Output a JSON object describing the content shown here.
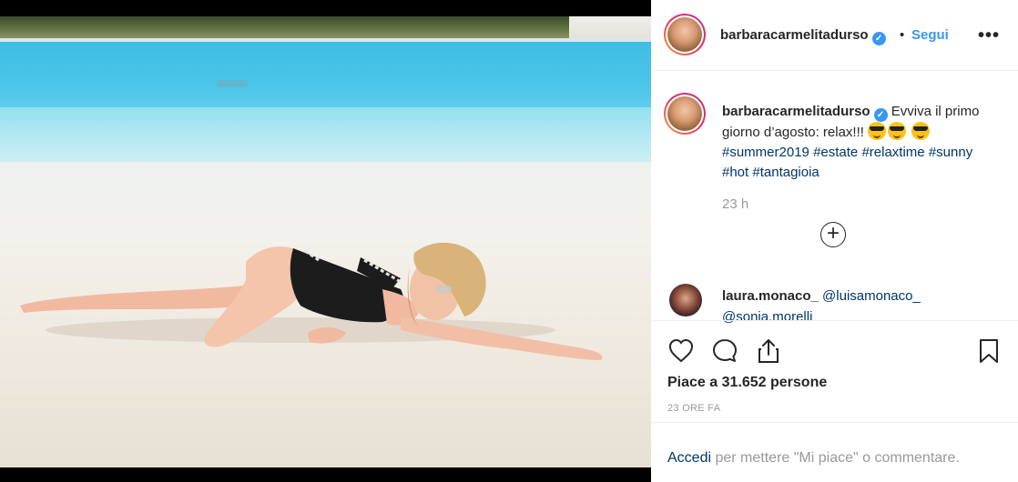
{
  "post": {
    "author": "barbaracarmelitadurso",
    "verified_mark": "✓",
    "dot": "•",
    "follow_label": "Segui",
    "more_label": "•••",
    "photo_icon": "beach-pool-photo"
  },
  "caption": {
    "username": "barbaracarmelitadurso",
    "text_before": " Evviva il primo giorno d’agosto: relax!!! ",
    "emoji_name": "smiling-face-with-sunglasses",
    "hashtags": [
      "#summer2019",
      "#estate",
      "#relaxtime",
      "#sunny",
      "#hot",
      "#tantagioia"
    ],
    "time": "23 h"
  },
  "load_more_label": "+",
  "comment": {
    "username": "laura.monaco_",
    "mentions": [
      "@luisamonaco_",
      "@sonia.morelli"
    ]
  },
  "actions": {
    "likes_prefix": "Piace a ",
    "likes_count": "31.652",
    "likes_suffix": " persone",
    "time_ago": "23 ORE FA"
  },
  "login": {
    "link_label": "Accedi",
    "rest": " per mettere \"Mi piace\" o commentare."
  }
}
